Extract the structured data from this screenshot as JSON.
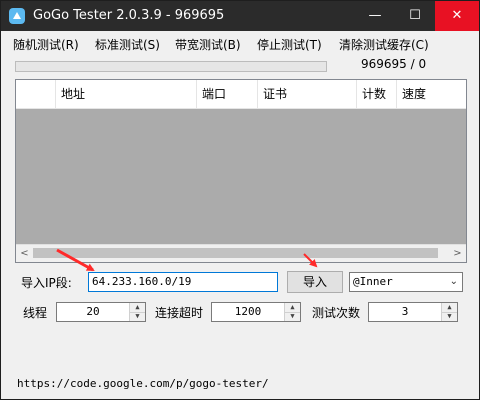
{
  "window": {
    "title": "GoGo Tester 2.0.3.9 - 969695",
    "minimize_glyph": "—",
    "maximize_glyph": "☐",
    "close_glyph": "✕"
  },
  "menu": {
    "items": [
      "随机测试(R)",
      "标准测试(S)",
      "带宽测试(B)",
      "停止测试(T)",
      "清除测试缓存(C)"
    ]
  },
  "progress": {
    "value": 0
  },
  "counter": "969695 / 0",
  "table": {
    "columns": [
      "",
      "地址",
      "端口",
      "证书",
      "计数",
      "速度"
    ],
    "rows": [],
    "scroll_left": "<",
    "scroll_right": ">"
  },
  "import": {
    "label": "导入IP段:",
    "value": "64.233.160.0/19",
    "button": "导入",
    "select_value": "@Inner",
    "select_chevron": "⌄"
  },
  "settings": {
    "threads_label": "线程",
    "threads_value": "20",
    "timeout_label": "连接超时",
    "timeout_value": "1200",
    "tries_label": "测试次数",
    "tries_value": "3",
    "spin_up": "▲",
    "spin_down": "▼"
  },
  "footer": {
    "url": "https://code.google.com/p/gogo-tester/"
  },
  "colors": {
    "titlebar": "#2b2b2b",
    "close_hover": "#e81123",
    "annotation_arrow": "#ff2a2a",
    "focus_border": "#0078d7"
  },
  "icons": [
    "app-logo-icon",
    "minimize-icon",
    "maximize-icon",
    "close-icon",
    "chevron-down-icon",
    "spin-up-icon",
    "spin-down-icon"
  ]
}
